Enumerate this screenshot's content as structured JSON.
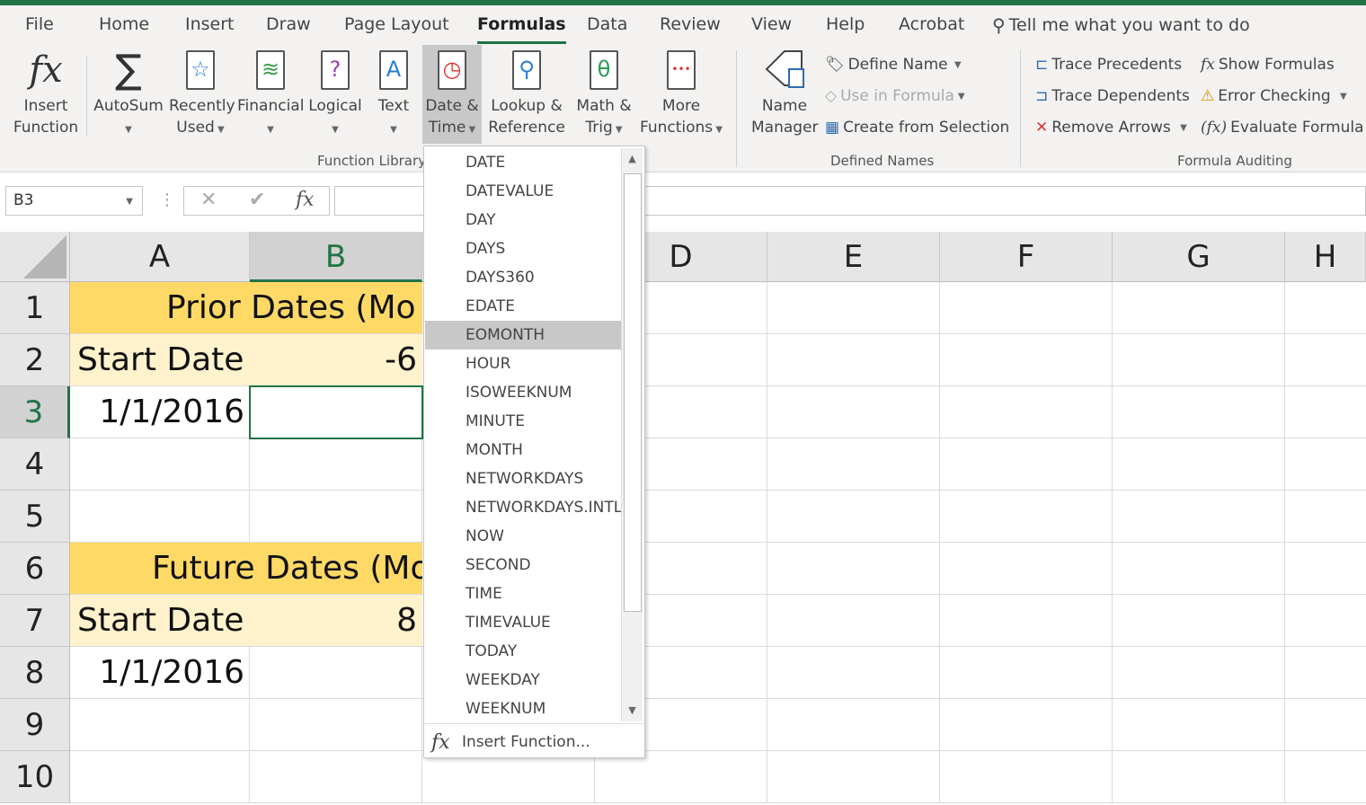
{
  "tabs": [
    "File",
    "Home",
    "Insert",
    "Draw",
    "Page Layout",
    "Formulas",
    "Data",
    "Review",
    "View",
    "Help",
    "Acrobat"
  ],
  "active_tab": "Formulas",
  "tell_me": "Tell me what you want to do",
  "function_library": {
    "group": "Function Library",
    "buttons": [
      {
        "l1": "Insert",
        "l2": "Function"
      },
      {
        "l1": "AutoSum",
        "l2": ""
      },
      {
        "l1": "Recently",
        "l2": "Used"
      },
      {
        "l1": "Financial",
        "l2": ""
      },
      {
        "l1": "Logical",
        "l2": ""
      },
      {
        "l1": "Text",
        "l2": ""
      },
      {
        "l1": "Date &",
        "l2": "Time"
      },
      {
        "l1": "Lookup &",
        "l2": "Reference"
      },
      {
        "l1": "Math &",
        "l2": "Trig"
      },
      {
        "l1": "More",
        "l2": "Functions"
      }
    ]
  },
  "defined_names": {
    "group": "Defined Names",
    "name_manager_1": "Name",
    "name_manager_2": "Manager",
    "define_name": "Define Name",
    "use_in_formula": "Use in Formula",
    "create_from_selection": "Create from Selection"
  },
  "formula_auditing": {
    "group": "Formula Auditing",
    "trace_precedents": "Trace Precedents",
    "trace_dependents": "Trace Dependents",
    "remove_arrows": "Remove Arrows",
    "show_formulas": "Show Formulas",
    "error_checking": "Error Checking",
    "evaluate_formula": "Evaluate Formula"
  },
  "name_box": "B3",
  "formula": "",
  "columns": [
    "A",
    "B",
    "C",
    "D",
    "E",
    "F",
    "G",
    "H"
  ],
  "rows": [
    "1",
    "2",
    "3",
    "4",
    "5",
    "6",
    "7",
    "8",
    "9",
    "10"
  ],
  "cells": {
    "A1": "Prior Dates (Mo",
    "A2": "Start Date",
    "B2": "-6",
    "A3": "1/1/2016",
    "A6": "Future Dates (Mo",
    "A7": "Start Date",
    "B7": "8",
    "A8": "1/1/2016"
  },
  "menu": {
    "items": [
      "DATE",
      "DATEVALUE",
      "DAY",
      "DAYS",
      "DAYS360",
      "EDATE",
      "EOMONTH",
      "HOUR",
      "ISOWEEKNUM",
      "MINUTE",
      "MONTH",
      "NETWORKDAYS",
      "NETWORKDAYS.INTL",
      "NOW",
      "SECOND",
      "TIME",
      "TIMEVALUE",
      "TODAY",
      "WEEKDAY",
      "WEEKNUM"
    ],
    "highlighted": "EOMONTH",
    "insert_function": "Insert Function..."
  },
  "colors": {
    "accent": "#217346",
    "header_fill": "#ffd966",
    "label_fill": "#fff2cc"
  }
}
